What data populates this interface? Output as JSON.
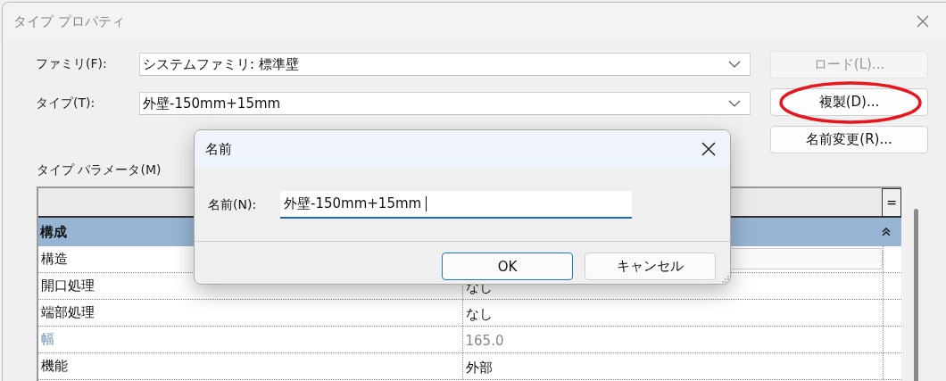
{
  "window": {
    "title": "タイプ プロパティ"
  },
  "fields": [
    {
      "label": "ファミリ(F):",
      "value": "システムファミリ: 標準壁"
    },
    {
      "label": "タイプ(T):",
      "value": "外壁-150mm+15mm"
    }
  ],
  "buttons": [
    {
      "label": "ロード(L)...",
      "disabled": true,
      "highlighted": false
    },
    {
      "label": "複製(D)...",
      "disabled": false,
      "highlighted": true
    },
    {
      "label": "名前変更(R)...",
      "disabled": false,
      "highlighted": false
    }
  ],
  "parameters": {
    "label": "タイプ パラメータ(M)",
    "header_button": "=",
    "group": {
      "label": "構成",
      "expanded": true
    },
    "rows": [
      {
        "name": "構造",
        "kind": "button",
        "readonly": false
      },
      {
        "name": "開口処理",
        "kind": "text",
        "value": "なし",
        "readonly": false
      },
      {
        "name": "端部処理",
        "kind": "text",
        "value": "なし",
        "readonly": false
      },
      {
        "name": "幅",
        "kind": "text",
        "value": "165.0",
        "readonly": true
      },
      {
        "name": "機能",
        "kind": "text",
        "value": "外部",
        "readonly": false
      }
    ]
  },
  "dialog": {
    "title": "名前",
    "field_label": "名前(N):",
    "value": "外壁-150mm+15mm ",
    "buttons": [
      {
        "label": "OK",
        "default": true
      },
      {
        "label": "キャンセル",
        "default": false
      }
    ]
  }
}
